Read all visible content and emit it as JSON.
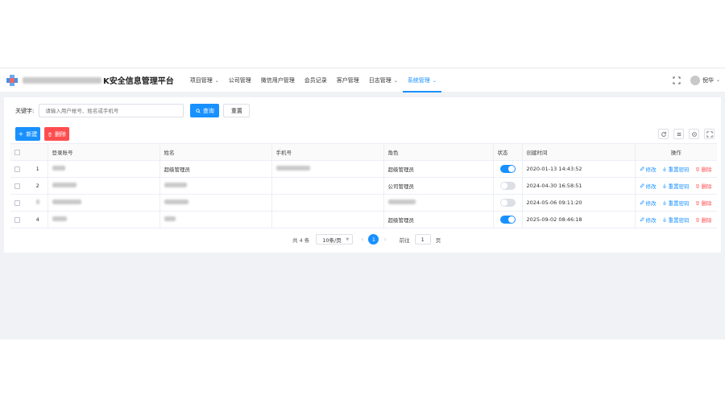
{
  "header": {
    "title_suffix": "K安全信息管理平台",
    "nav": [
      {
        "label": "项目管理",
        "dropdown": true
      },
      {
        "label": "公司管理",
        "dropdown": false
      },
      {
        "label": "微信用户管理",
        "dropdown": false
      },
      {
        "label": "会员记录",
        "dropdown": false
      },
      {
        "label": "客户管理",
        "dropdown": false
      },
      {
        "label": "日志管理",
        "dropdown": true
      },
      {
        "label": "系统管理",
        "dropdown": true,
        "active": true
      }
    ],
    "username": "倪华"
  },
  "search": {
    "label": "关键字:",
    "placeholder": "请输入用户帐号、姓名或手机号",
    "query_button": "查询",
    "reset_button": "重置"
  },
  "toolbar": {
    "add_button": "新建",
    "delete_button": "删除"
  },
  "table": {
    "columns": [
      "登录账号",
      "姓名",
      "手机号",
      "角色",
      "状态",
      "创建时间",
      "操作"
    ],
    "rows": [
      {
        "index": "1",
        "name": "超级管理员",
        "role": "超级管理员",
        "status_on": true,
        "created": "2020-01-13 14:43:52"
      },
      {
        "index": "2",
        "name": "",
        "role": "公司管理员",
        "status_on": false,
        "created": "2024-04-30 16:58:51"
      },
      {
        "index": "3",
        "name": "",
        "role": "",
        "status_on": false,
        "created": "2024-05-06 09:11:20"
      },
      {
        "index": "4",
        "name": "",
        "role": "超级管理员",
        "status_on": true,
        "created": "2025-09-02 08:46:18"
      }
    ],
    "actions": {
      "edit": "修改",
      "reset_password": "重置密码",
      "delete": "删除"
    }
  },
  "pagination": {
    "total": "共 4 条",
    "page_size": "10条/页",
    "current_page": "1",
    "goto_label": "前往",
    "goto_value": "1",
    "goto_unit": "页"
  },
  "colors": {
    "primary": "#1890ff",
    "danger": "#ff4d4f",
    "background": "#f0f2f5"
  }
}
